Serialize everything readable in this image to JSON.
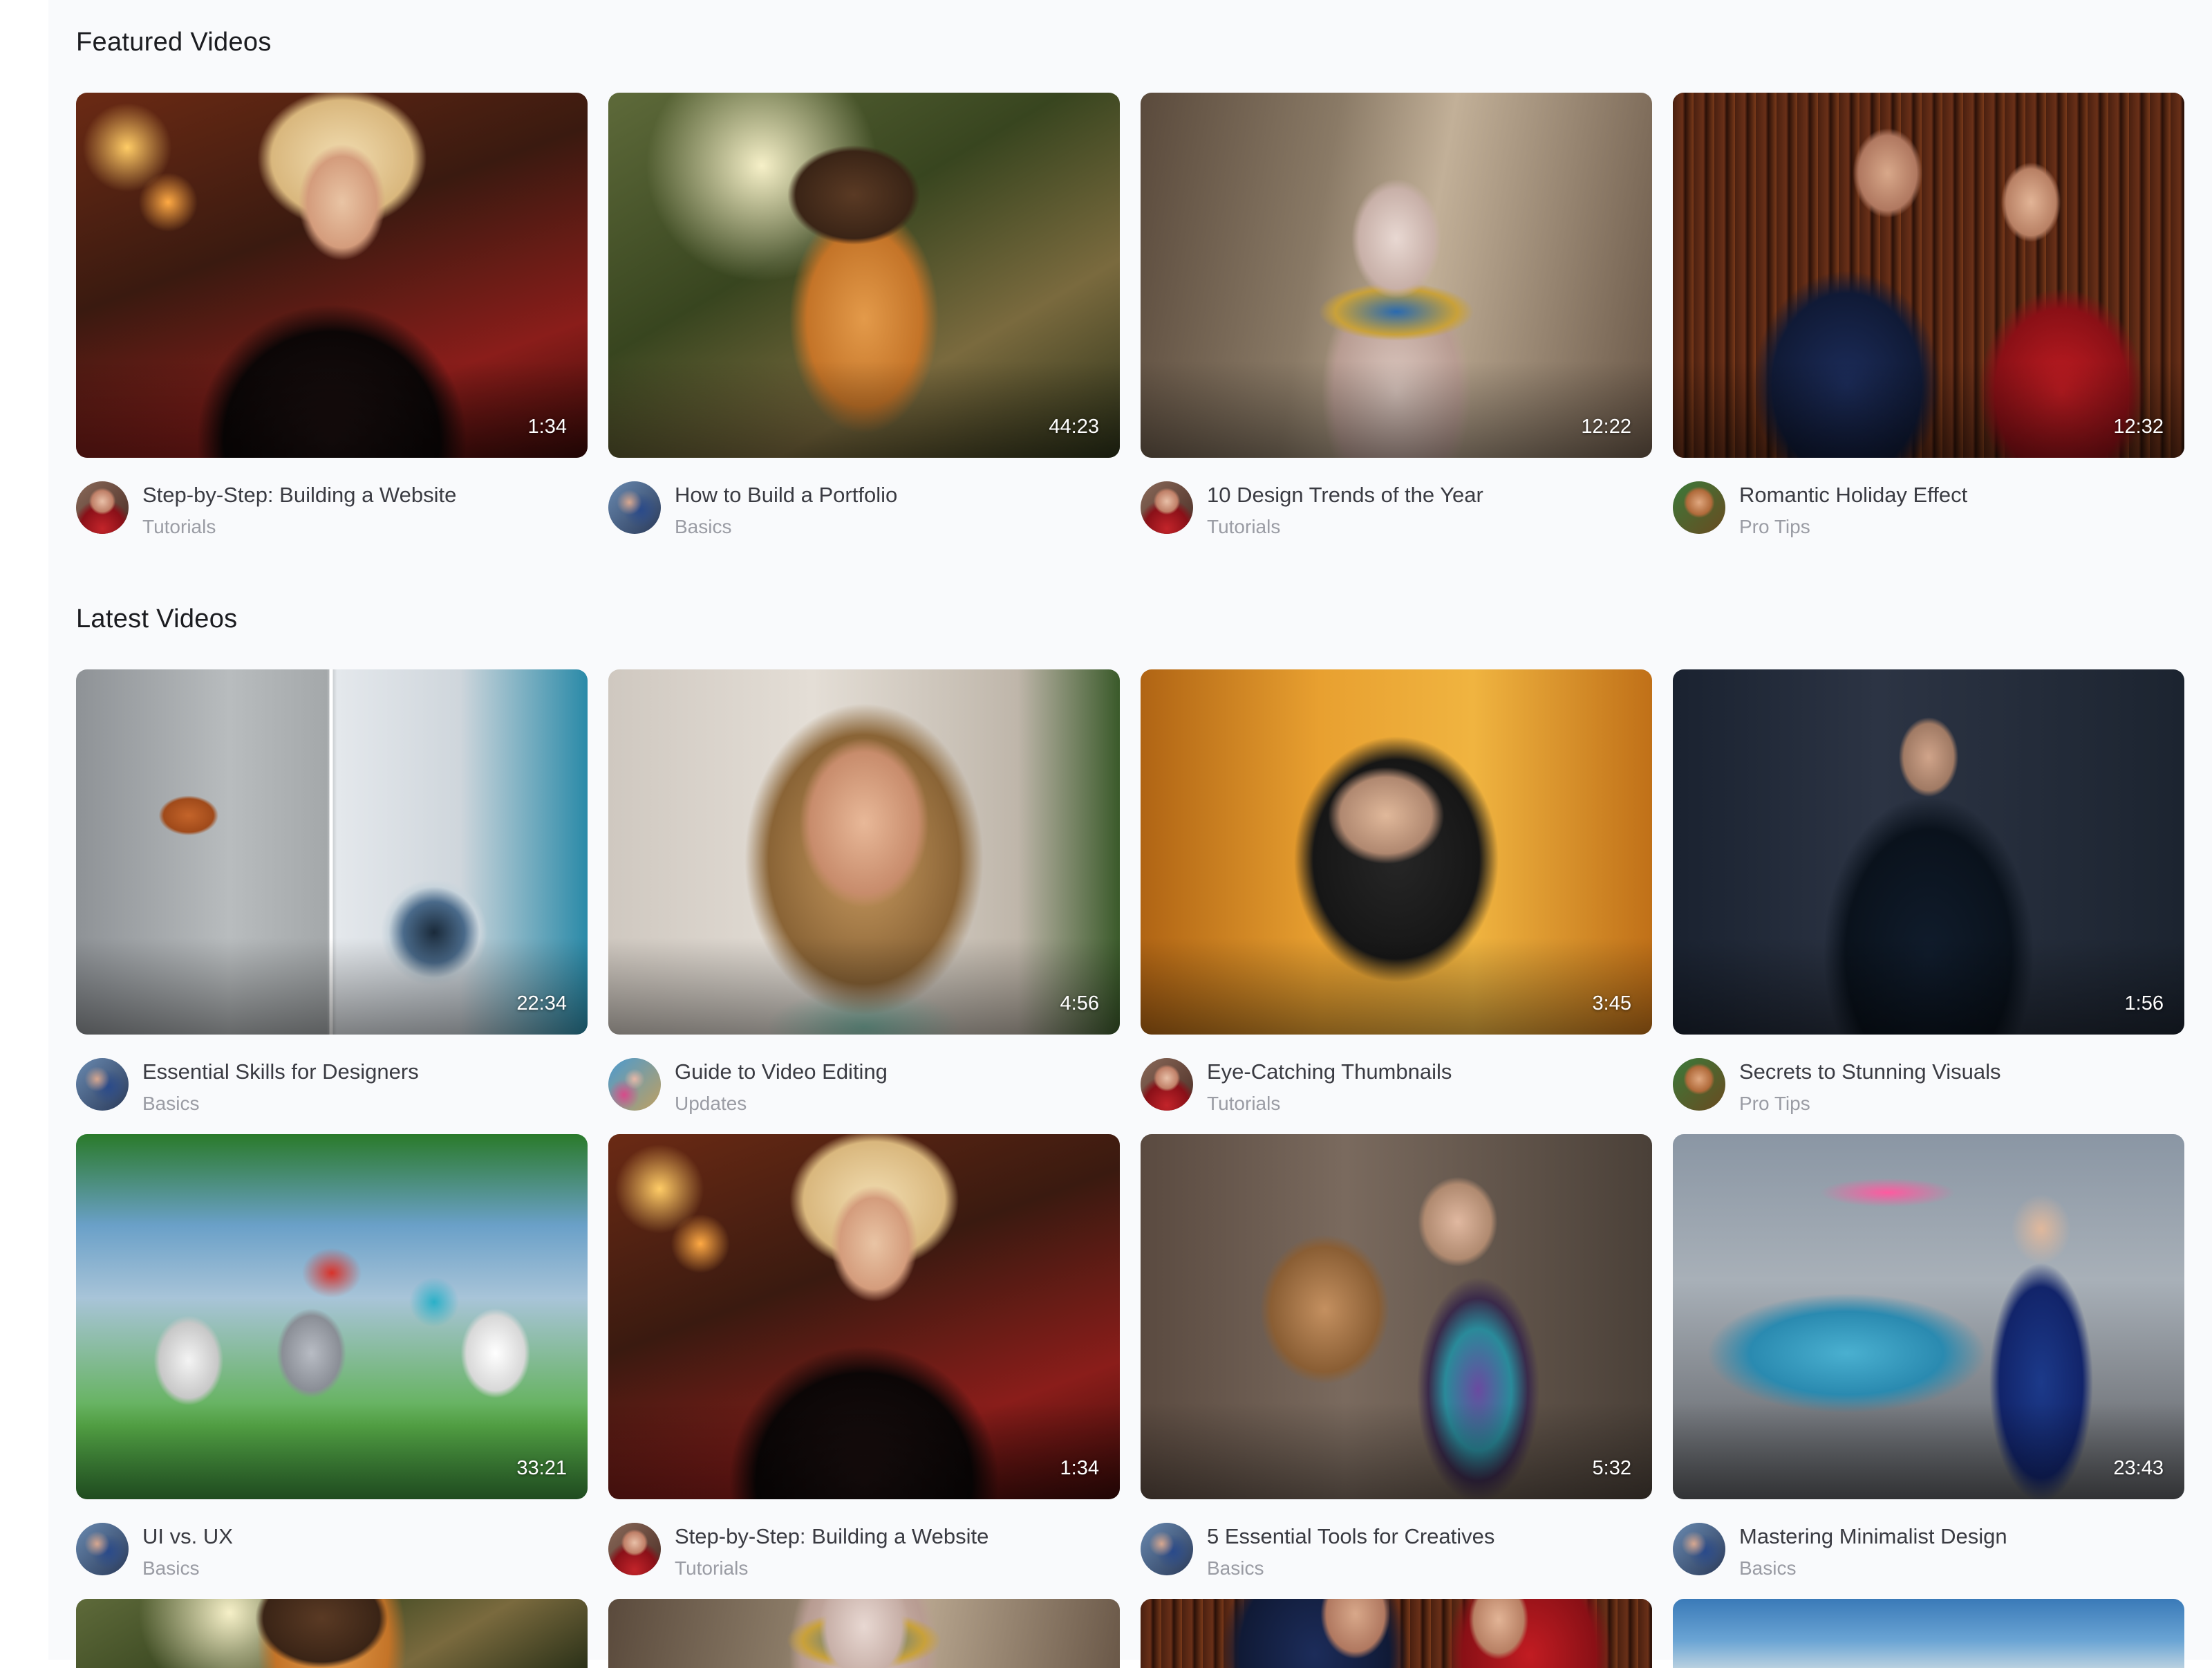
{
  "featured": {
    "heading": "Featured Videos",
    "videos": [
      {
        "title": "Step-by-Step: Building a Website",
        "category": "Tutorials",
        "duration": "1:34",
        "thumb": "blonde-latex-woman",
        "avatar": "red-dress-woman"
      },
      {
        "title": "How to Build a Portfolio",
        "category": "Basics",
        "duration": "44:23",
        "thumb": "explorer-cat-jungle",
        "avatar": "couple-blue"
      },
      {
        "title": "10 Design Trends of the Year",
        "category": "Tutorials",
        "duration": "12:22",
        "thumb": "sphynx-cat-pharaoh",
        "avatar": "red-dress-woman"
      },
      {
        "title": "Romantic Holiday Effect",
        "category": "Pro Tips",
        "duration": "12:32",
        "thumb": "couple-library",
        "avatar": "green-character"
      }
    ]
  },
  "latest": {
    "heading": "Latest Videos",
    "videos": [
      {
        "title": "Essential Skills for Designers",
        "category": "Basics",
        "duration": "22:34",
        "thumb": "car-before-after",
        "avatar": "couple-blue"
      },
      {
        "title": "Guide to Video Editing",
        "category": "Updates",
        "duration": "4:56",
        "thumb": "woman-portrait",
        "avatar": "colorful-group"
      },
      {
        "title": "Eye-Catching Thumbnails",
        "category": "Tutorials",
        "duration": "3:45",
        "thumb": "gas-mask-woman",
        "avatar": "red-dress-woman"
      },
      {
        "title": "Secrets to Stunning Visuals",
        "category": "Pro Tips",
        "duration": "1:56",
        "thumb": "woman-sunglasses-latex",
        "avatar": "green-character"
      },
      {
        "title": "UI vs. UX",
        "category": "Basics",
        "duration": "33:21",
        "thumb": "lego-figures",
        "avatar": "couple-blue"
      },
      {
        "title": "Step-by-Step: Building a Website",
        "category": "Tutorials",
        "duration": "1:34",
        "thumb": "blonde-latex-woman",
        "avatar": "red-dress-woman"
      },
      {
        "title": "5 Essential Tools for Creatives",
        "category": "Basics",
        "duration": "5:32",
        "thumb": "woman-hugging-lion",
        "avatar": "couple-blue"
      },
      {
        "title": "Mastering Minimalist Design",
        "category": "Basics",
        "duration": "23:43",
        "thumb": "coffee-quest-plane",
        "avatar": "couple-blue"
      }
    ],
    "partial_row_thumbs": [
      "explorer-cat-jungle",
      "sphynx-cat-pharaoh",
      "couple-library",
      "sky-scene"
    ]
  }
}
